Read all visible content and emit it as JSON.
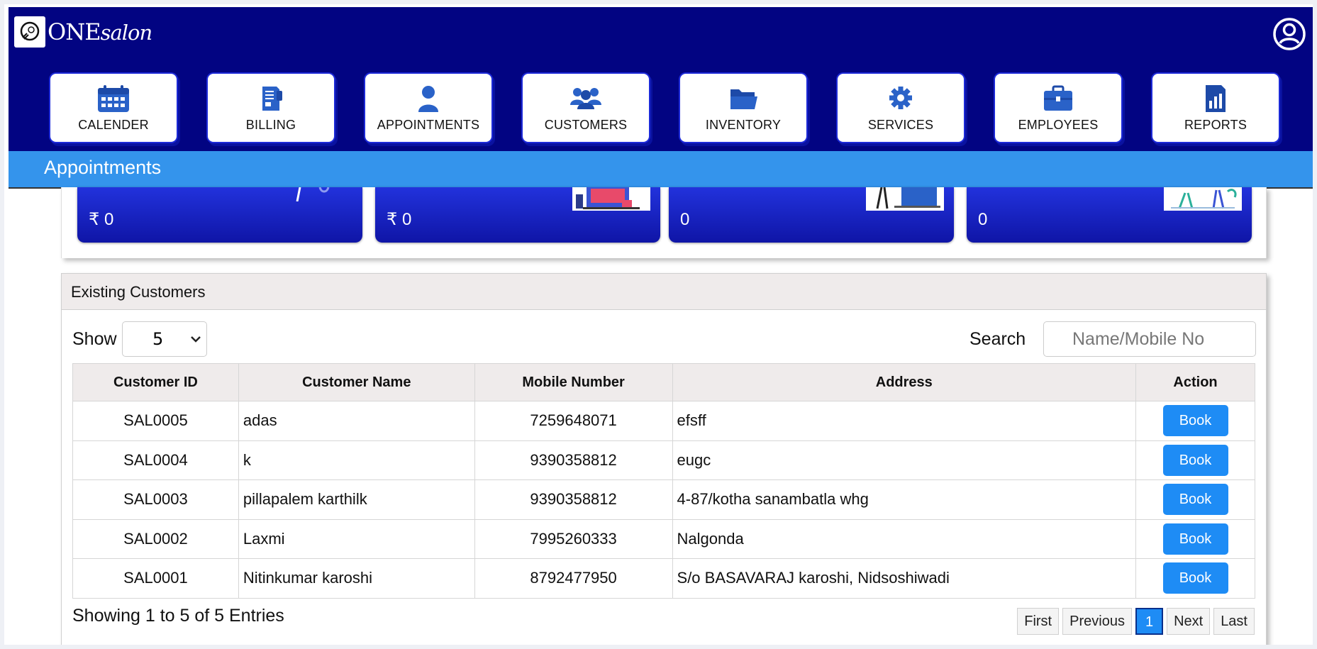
{
  "app": {
    "logo_main": "ONE",
    "logo_script": "salon"
  },
  "nav": {
    "items": [
      {
        "label": "CALENDER",
        "icon": "calendar-icon"
      },
      {
        "label": "BILLING",
        "icon": "billing-icon"
      },
      {
        "label": "APPOINTMENTS",
        "icon": "person-icon"
      },
      {
        "label": "CUSTOMERS",
        "icon": "customers-icon"
      },
      {
        "label": "INVENTORY",
        "icon": "folder-icon"
      },
      {
        "label": "SERVICES",
        "icon": "gear-icon"
      },
      {
        "label": "EMPLOYEES",
        "icon": "briefcase-icon"
      },
      {
        "label": "REPORTS",
        "icon": "report-icon"
      }
    ]
  },
  "page_title": "Appointments",
  "stats": [
    {
      "value": "₹ 0"
    },
    {
      "value": "₹ 0"
    },
    {
      "value": "0"
    },
    {
      "value": "0"
    }
  ],
  "customers": {
    "heading": "Existing Customers",
    "show_label": "Show",
    "show_value": "5",
    "search_label": "Search",
    "search_placeholder": "Name/Mobile No",
    "columns": [
      "Customer ID",
      "Customer Name",
      "Mobile Number",
      "Address",
      "Action"
    ],
    "rows": [
      {
        "id": "SAL0005",
        "name": "adas",
        "mobile": "7259648071",
        "address": "efsff",
        "action": "Book"
      },
      {
        "id": "SAL0004",
        "name": "k",
        "mobile": "9390358812",
        "address": "eugc",
        "action": "Book"
      },
      {
        "id": "SAL0003",
        "name": "pillapalem karthilk",
        "mobile": "9390358812",
        "address": "4-87/kotha sanambatla whg",
        "action": "Book"
      },
      {
        "id": "SAL0002",
        "name": "Laxmi",
        "mobile": "7995260333",
        "address": "Nalgonda",
        "action": "Book"
      },
      {
        "id": "SAL0001",
        "name": "Nitinkumar karoshi",
        "mobile": "8792477950",
        "address": "S/o BASAVARAJ karoshi, Nidsoshiwadi",
        "action": "Book"
      }
    ],
    "showing_text": "Showing 1 to 5 of 5 Entries",
    "pagination": {
      "first": "First",
      "previous": "Previous",
      "current": "1",
      "next": "Next",
      "last": "Last"
    }
  },
  "colors": {
    "header": "#020482",
    "subheader": "#3494ec",
    "accent": "#1e8cf5"
  }
}
